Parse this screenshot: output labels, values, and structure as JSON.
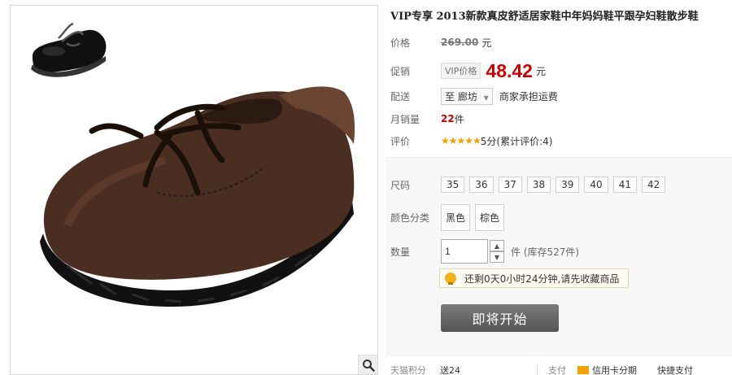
{
  "product": {
    "title": "VIP专享 2013新款真皮舒适居家鞋中年妈妈鞋平跟孕妇鞋散步鞋",
    "price_label": "价格",
    "original_price": "269.00",
    "currency_unit": "元",
    "promo_label": "促销",
    "vip_tag": "VIP价格",
    "promo_price": "48.42",
    "shipping_label": "配送",
    "ship_to": "至 廊坊",
    "shipping_note": "商家承担运费",
    "monthly_sales_label": "月销量",
    "monthly_sales_value": "22",
    "monthly_sales_unit": "件",
    "rating_label": "评价",
    "rating_stars": "★★★★★",
    "rating_text": "5分(累计评价:4)"
  },
  "options": {
    "size_label": "尺码",
    "sizes": [
      "35",
      "36",
      "37",
      "38",
      "39",
      "40",
      "41",
      "42"
    ],
    "color_label": "颜色分类",
    "colors": [
      "黑色",
      "棕色"
    ],
    "qty_label": "数量",
    "qty_value": "1",
    "stock_text": "件 (库存527件)",
    "notice": "还剩0天0小时24分钟,请先收藏商品",
    "start_button": "即将开始"
  },
  "footer": {
    "points_label": "天猫积分",
    "points_value": "送24",
    "pay_label": "支付",
    "credit_card": "信用卡分期",
    "quick_pay": "快捷支付"
  },
  "colors": {
    "price_red": "#c40000",
    "star_gold": "#f0a000",
    "button_gray": "#666666"
  },
  "icons": {
    "zoom": "magnifier-icon",
    "notice": "lightbulb-icon",
    "stepper_up": "chevron-up-icon",
    "stepper_down": "chevron-down-icon",
    "dropdown": "triangle-down-icon"
  }
}
